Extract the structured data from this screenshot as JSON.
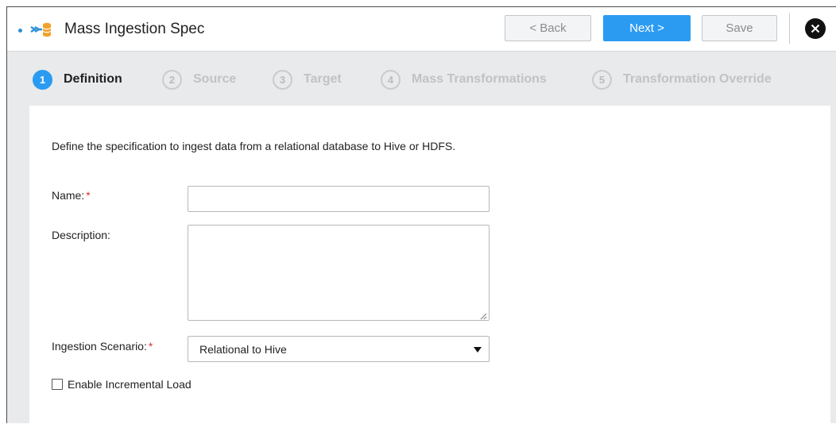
{
  "header": {
    "title": "Mass Ingestion Spec",
    "icon": "mass-ingestion-icon",
    "back_label": "< Back",
    "next_label": "Next >",
    "save_label": "Save",
    "close_icon": "close-icon"
  },
  "steps": [
    {
      "num": "1",
      "label": "Definition",
      "active": true
    },
    {
      "num": "2",
      "label": "Source",
      "active": false
    },
    {
      "num": "3",
      "label": "Target",
      "active": false
    },
    {
      "num": "4",
      "label": "Mass Transformations",
      "active": false
    },
    {
      "num": "5",
      "label": "Transformation Override",
      "active": false
    }
  ],
  "form": {
    "intro": "Define the specification to ingest data from a relational database to Hive or HDFS.",
    "name_label": "Name:",
    "name_value": "",
    "required_mark": "*",
    "description_label": "Description:",
    "description_value": "",
    "scenario_label": "Ingestion Scenario:",
    "scenario_value": "Relational to Hive",
    "incremental_label": "Enable Incremental Load",
    "incremental_checked": false
  },
  "colors": {
    "accent": "#2b9bf2",
    "required": "#d9342b",
    "icon_orange": "#f2a22a"
  }
}
